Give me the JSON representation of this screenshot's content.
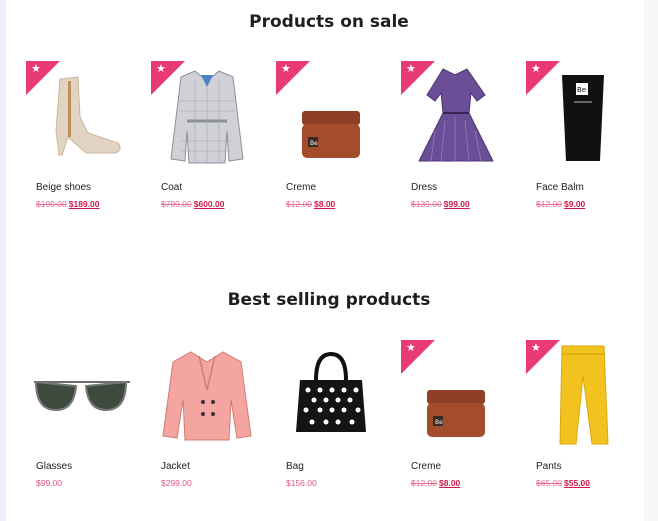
{
  "sections": [
    {
      "title": "Products on sale",
      "products": [
        {
          "name": "Beige shoes",
          "old_price": "$199.00",
          "price": "$189.00",
          "sale": true,
          "icon": "boot-icon"
        },
        {
          "name": "Coat",
          "old_price": "$799.00",
          "price": "$600.00",
          "sale": true,
          "icon": "coat-icon"
        },
        {
          "name": "Creme",
          "old_price": "$12.00",
          "price": "$8.00",
          "sale": true,
          "icon": "cream-jar-icon"
        },
        {
          "name": "Dress",
          "old_price": "$139.00",
          "price": "$99.00",
          "sale": true,
          "icon": "dress-icon"
        },
        {
          "name": "Face Balm",
          "old_price": "$12.00",
          "price": "$9.00",
          "sale": true,
          "icon": "face-balm-tube-icon"
        }
      ]
    },
    {
      "title": "Best selling products",
      "products": [
        {
          "name": "Glasses",
          "price": "$99.00",
          "sale": false,
          "icon": "sunglasses-icon"
        },
        {
          "name": "Jacket",
          "price": "$299.00",
          "sale": false,
          "icon": "jacket-icon"
        },
        {
          "name": "Bag",
          "price": "$156.00",
          "sale": false,
          "icon": "handbag-icon"
        },
        {
          "name": "Creme",
          "old_price": "$12.00",
          "price": "$8.00",
          "sale": true,
          "icon": "cream-jar-icon"
        },
        {
          "name": "Pants",
          "old_price": "$65.00",
          "price": "$55.00",
          "sale": true,
          "icon": "pants-icon"
        }
      ]
    }
  ],
  "colors": {
    "ribbon": "#e83a74",
    "price": "#cc1a4d",
    "old_price": "#e56d92"
  }
}
